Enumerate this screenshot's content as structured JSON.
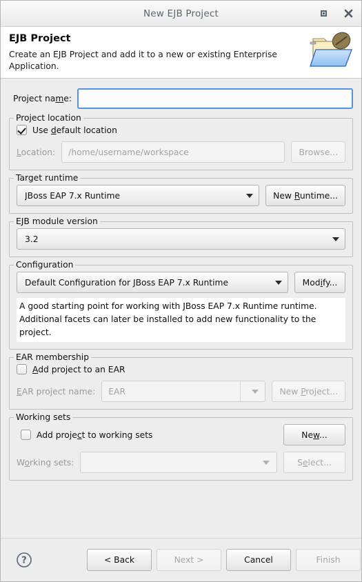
{
  "window": {
    "title": "New EJB Project",
    "maximize_label": "maximize",
    "close_label": "close"
  },
  "header": {
    "title": "EJB Project",
    "description": "Create an EJB Project and add it to a new or existing Enterprise Application.",
    "icon": "ejb-project-folder-icon"
  },
  "project_name": {
    "label": "Project name:",
    "value": "",
    "placeholder": ""
  },
  "project_location": {
    "legend": "Project location",
    "use_default_label": "Use default location",
    "use_default_checked": true,
    "location_label": "Location:",
    "location_value": "/home/username/workspace",
    "browse_label": "Browse..."
  },
  "target_runtime": {
    "legend": "Target runtime",
    "selected": "JBoss EAP 7.x Runtime",
    "new_runtime_label": "New Runtime..."
  },
  "ejb_module_version": {
    "legend": "EJB module version",
    "selected": "3.2"
  },
  "configuration": {
    "legend": "Configuration",
    "selected": "Default Configuration for JBoss EAP 7.x Runtime",
    "modify_label": "Modify...",
    "description": "A good starting point for working with JBoss EAP 7.x Runtime runtime. Additional facets can later be installed to add new functionality to the project."
  },
  "ear_membership": {
    "legend": "EAR membership",
    "add_to_ear_label": "Add project to an EAR",
    "add_to_ear_checked": false,
    "ear_project_name_label": "EAR project name:",
    "ear_project_name_value": "EAR",
    "new_project_label": "New Project..."
  },
  "working_sets": {
    "legend": "Working sets",
    "add_to_working_sets_label": "Add project to working sets",
    "add_to_working_sets_checked": false,
    "working_sets_label": "Working sets:",
    "working_sets_value": "",
    "new_label": "New...",
    "select_label": "Select..."
  },
  "footer": {
    "help_icon": "help-question-icon",
    "back_label": "< Back",
    "next_label": "Next >",
    "cancel_label": "Cancel",
    "finish_label": "Finish"
  },
  "colors": {
    "dialog_bg": "#ededed",
    "focus_border": "#5294e2",
    "header_bg": "#ffffff",
    "title_text": "#5a666e"
  }
}
